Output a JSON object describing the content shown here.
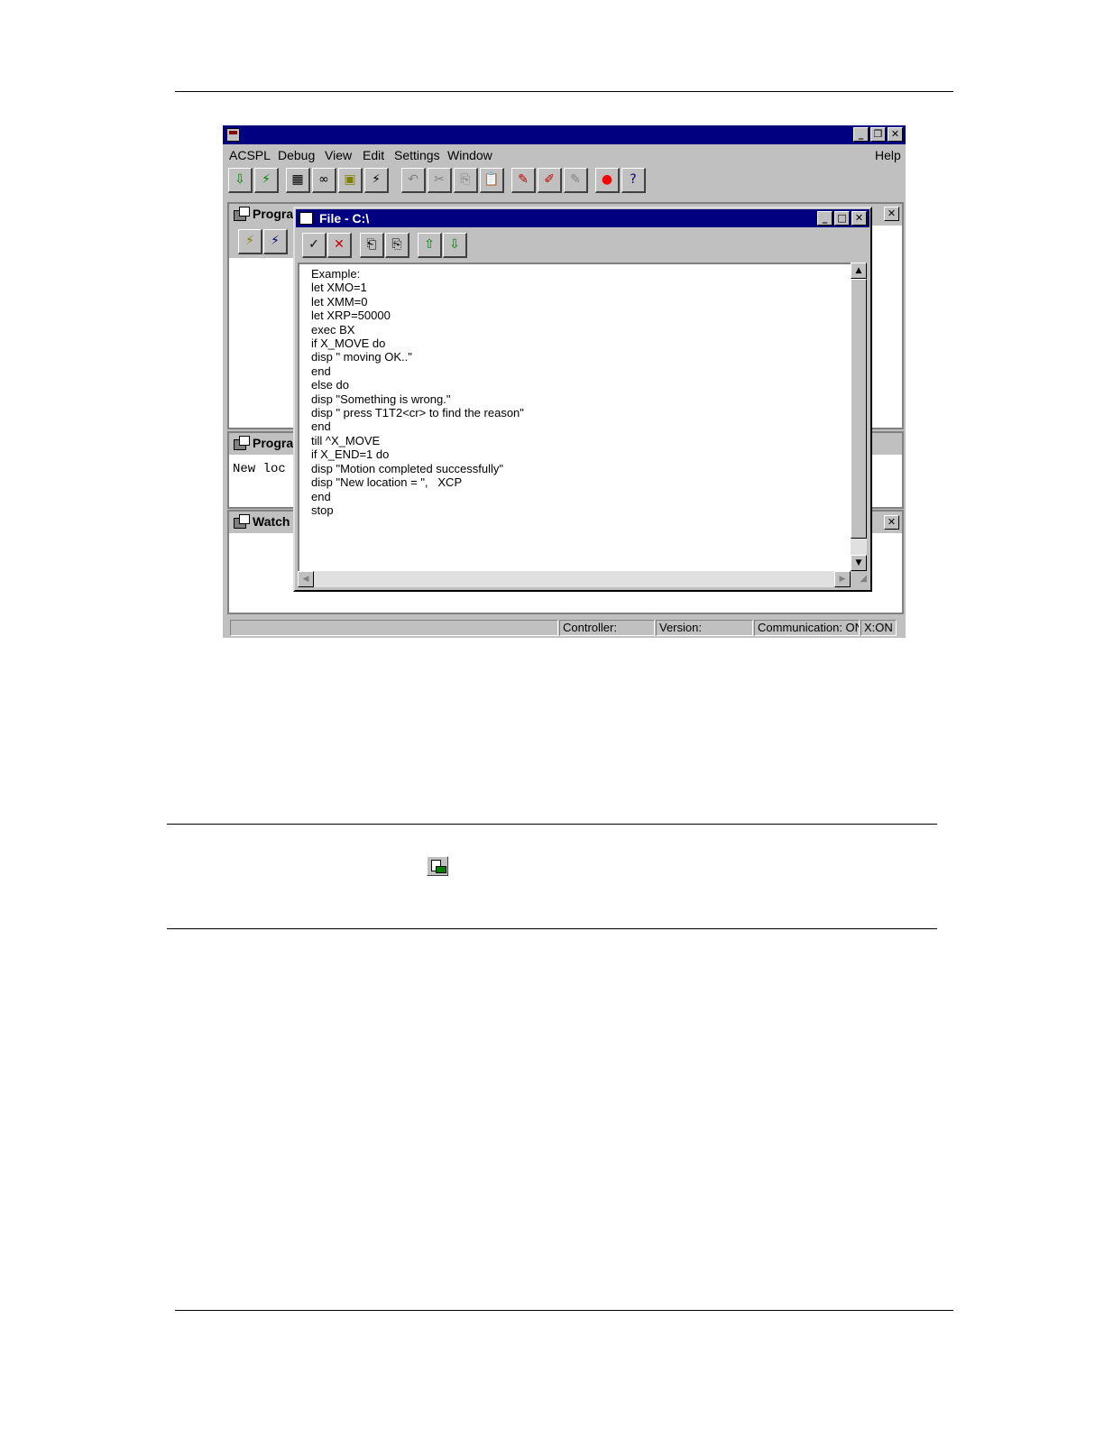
{
  "menubar": {
    "items": [
      {
        "label": "ACSPL"
      },
      {
        "label": "Debug"
      },
      {
        "label": "View"
      },
      {
        "label": "Edit"
      },
      {
        "label": "Settings"
      },
      {
        "label": "Window"
      }
    ],
    "help": "Help"
  },
  "window_controls": {
    "minimize": "_",
    "restore": "❐",
    "maximize": "□",
    "close": "✕"
  },
  "toolbar": {
    "icons": [
      "download-icon",
      "upload-icon",
      "calculator-icon",
      "watch-glasses-icon",
      "notepad-icon",
      "lightning-icon",
      "undo-icon",
      "cut-icon",
      "copy-icon",
      "paste-icon",
      "marker-icon",
      "marker-ab-icon",
      "marker-disabled-icon",
      "stop-icon",
      "help-icon"
    ]
  },
  "panels": {
    "program_top": {
      "title": "Prograr"
    },
    "program_mid": {
      "title": "Prograr",
      "content": "New loc"
    },
    "watch": {
      "title": "Watch"
    }
  },
  "file_window": {
    "title": "File - C:\\",
    "toolbar_icons": [
      "check-icon",
      "cancel-x-icon",
      "file-open-icon",
      "file-save-icon",
      "load-icon",
      "save-controller-icon"
    ],
    "lines": [
      "Example:",
      "let XMO=1",
      "let XMM=0",
      "let XRP=50000",
      "exec BX",
      "if X_MOVE do",
      "disp \" moving OK..\"",
      "end",
      "else do",
      "disp \"Something is wrong.\"",
      "disp \" press T1T2<cr> to find the reason\"",
      "end",
      "till ^X_MOVE",
      "if X_END=1 do",
      "disp \"Motion completed successfully\"",
      "disp \"New location = \",   XCP",
      "end",
      "stop"
    ]
  },
  "statusbar": {
    "controller": "Controller:",
    "version": "Version:",
    "communication": "Communication: ON",
    "axis": "X:ON"
  }
}
